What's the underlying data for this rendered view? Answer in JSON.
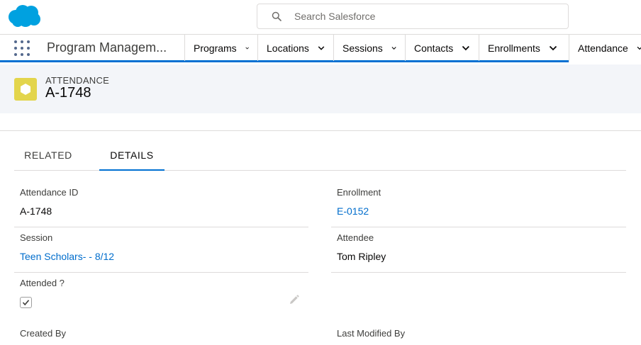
{
  "search": {
    "placeholder": "Search Salesforce"
  },
  "app": {
    "name": "Program Managem..."
  },
  "nav": {
    "tabs": [
      {
        "label": "Programs"
      },
      {
        "label": "Locations"
      },
      {
        "label": "Sessions"
      },
      {
        "label": "Contacts"
      },
      {
        "label": "Enrollments"
      },
      {
        "label": "Attendance"
      }
    ]
  },
  "record": {
    "object_type": "ATTENDANCE",
    "title": "A-1748"
  },
  "detail_tabs": [
    {
      "label": "RELATED"
    },
    {
      "label": "DETAILS"
    }
  ],
  "fields": {
    "attendance_id": {
      "label": "Attendance ID",
      "value": "A-1748"
    },
    "enrollment": {
      "label": "Enrollment",
      "value": "E-0152"
    },
    "session": {
      "label": "Session",
      "value": "Teen Scholars- - 8/12"
    },
    "attendee": {
      "label": "Attendee",
      "value": "Tom Ripley"
    },
    "attended": {
      "label": "Attended ?",
      "checked": true
    },
    "created_by": {
      "label": "Created By"
    },
    "last_modified_by": {
      "label": "Last Modified By"
    }
  },
  "colors": {
    "brand": "#00a1e0",
    "accent": "#0070d2",
    "link": "#006dcc",
    "object_icon": "#e3d54c"
  }
}
